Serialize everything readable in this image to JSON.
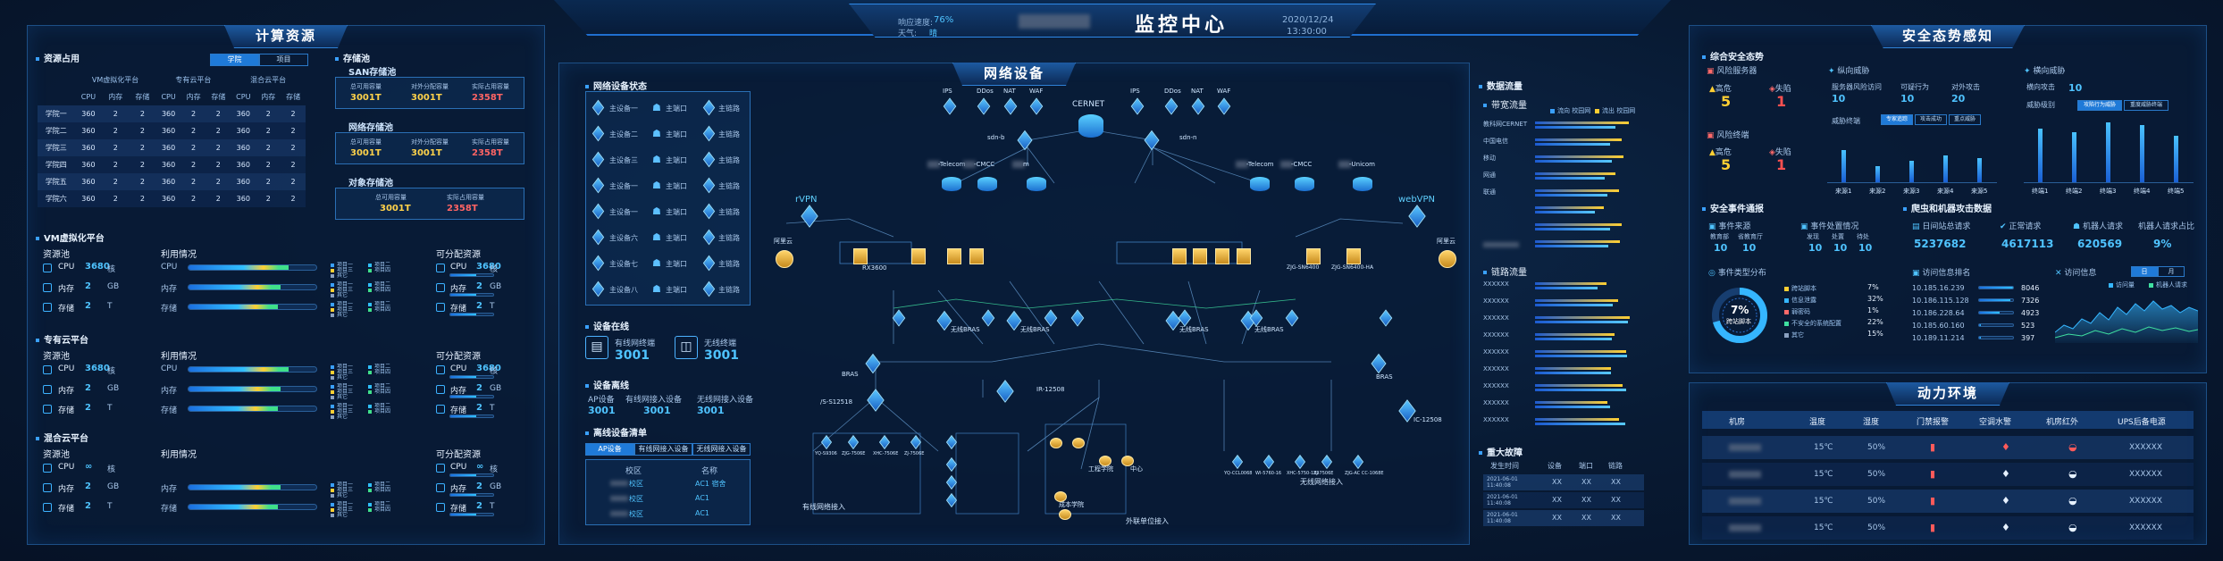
{
  "header": {
    "title": "监控中心",
    "left_label1": "响应速度:",
    "left_val1": "76%",
    "left_label2": "天气:",
    "left_val2": "晴",
    "date": "2020/12/24",
    "time": "13:30:00"
  },
  "left": {
    "title": "计算资源",
    "resource_usage": "资源占用",
    "tabs": [
      "学院",
      "项目"
    ],
    "table_groups": [
      "VM虚拟化平台",
      "专有云平台",
      "混合云平台"
    ],
    "table_cols": [
      "CPU",
      "内存",
      "存储",
      "CPU",
      "内存",
      "存储",
      "CPU",
      "内存",
      "存储"
    ],
    "rows": [
      {
        "name": "学院一",
        "vals": [
          "360",
          "2",
          "2",
          "360",
          "2",
          "2",
          "360",
          "2",
          "2"
        ]
      },
      {
        "name": "学院二",
        "vals": [
          "360",
          "2",
          "2",
          "360",
          "2",
          "2",
          "360",
          "2",
          "2"
        ]
      },
      {
        "name": "学院三",
        "vals": [
          "360",
          "2",
          "2",
          "360",
          "2",
          "2",
          "360",
          "2",
          "2"
        ]
      },
      {
        "name": "学院四",
        "vals": [
          "360",
          "2",
          "2",
          "360",
          "2",
          "2",
          "360",
          "2",
          "2"
        ]
      },
      {
        "name": "学院五",
        "vals": [
          "360",
          "2",
          "2",
          "360",
          "2",
          "2",
          "360",
          "2",
          "2"
        ]
      },
      {
        "name": "学院六",
        "vals": [
          "360",
          "2",
          "2",
          "360",
          "2",
          "2",
          "360",
          "2",
          "2"
        ]
      }
    ],
    "storage": "存储池",
    "san": {
      "title": "SAN存储池",
      "l1": "总可用容量",
      "l2": "对外分配容量",
      "l3": "实际占用容量",
      "v1": "3001T",
      "v2": "3001T",
      "v3": "2358T"
    },
    "nas": {
      "title": "网络存储池",
      "l1": "总可用容量",
      "l2": "对外分配容量",
      "l3": "实际占用容量",
      "v1": "3001T",
      "v2": "3001T",
      "v3": "2358T"
    },
    "obj": {
      "title": "对象存储池",
      "l1": "总可用容量",
      "l2": "实际占用容量",
      "v1": "3001T",
      "v2": "2358T"
    },
    "platforms": [
      {
        "name": "VM虚拟化平台",
        "res": "资源池",
        "use": "利用情况",
        "alloc": "可分配资源",
        "cpu": "3680",
        "mem": "2",
        "disk": "2",
        "u_cpu": "CPU",
        "u_mem": "内存",
        "u_disk": "存储",
        "cpu_pct": 0.78,
        "mem_pct": 0.72,
        "disk_pct": 0.7,
        "a_cpu": "3680",
        "a_mem": "2",
        "a_disk": "2"
      },
      {
        "name": "专有云平台",
        "res": "资源池",
        "use": "利用情况",
        "alloc": "可分配资源",
        "cpu": "3680",
        "mem": "2",
        "disk": "2",
        "u_cpu": "CPU",
        "u_mem": "内存",
        "u_disk": "存储",
        "cpu_pct": 0.78,
        "mem_pct": 0.72,
        "disk_pct": 0.7,
        "a_cpu": "3680",
        "a_mem": "2",
        "a_disk": "2"
      },
      {
        "name": "混合云平台",
        "res": "资源池",
        "use": "利用情况",
        "alloc": "可分配资源",
        "cpu": "∞",
        "mem": "2",
        "disk": "2",
        "u_cpu": "",
        "u_mem": "内存",
        "u_disk": "存储",
        "cpu_pct": 0,
        "mem_pct": 0.72,
        "disk_pct": 0.7,
        "a_cpu": "∞",
        "a_mem": "2",
        "a_disk": "2"
      }
    ],
    "units": {
      "core": "核",
      "gb": "GB",
      "t": "T"
    },
    "legend": [
      "项目一",
      "项目二",
      "项目三",
      "项目四",
      "其它"
    ]
  },
  "middle": {
    "title": "网络设备",
    "status_title": "网络设备状态",
    "devices": [
      {
        "n": "主设备一",
        "a": "主端口",
        "b": "主链路"
      },
      {
        "n": "主设备二",
        "a": "主端口",
        "b": "主链路"
      },
      {
        "n": "主设备三",
        "a": "主端口",
        "b": "主链路"
      },
      {
        "n": "主设备一",
        "a": "主端口",
        "b": "主链路"
      },
      {
        "n": "主设备一",
        "a": "主端口",
        "b": "主链路"
      },
      {
        "n": "主设备六",
        "a": "主端口",
        "b": "主链路"
      },
      {
        "n": "主设备七",
        "a": "主端口",
        "b": "主链路"
      },
      {
        "n": "主设备八",
        "a": "主端口",
        "b": "主链路"
      }
    ],
    "online_title": "设备在线",
    "wired": "有线网终端",
    "wired_v": "3001",
    "wireless": "无线终端",
    "wireless_v": "3001",
    "offline_title": "设备离线",
    "ap": "AP设备",
    "ap_v": "3001",
    "wired_in": "有线网接入设备",
    "wired_in_v": "3001",
    "wireless_in": "无线网接入设备",
    "wireless_in_v": "3001",
    "offline_list": "离线设备清单",
    "list_tabs": [
      "AP设备",
      "有线网接入设备",
      "无线网接入设备"
    ],
    "list_head": [
      "校区",
      "名称"
    ],
    "list_rows": [
      {
        "a": "校区",
        "b": "AC1 宿舍"
      },
      {
        "a": "校区",
        "b": "AC1"
      },
      {
        "a": "校区",
        "b": "AC1"
      }
    ],
    "topo": {
      "top_left": [
        "IPS",
        "DDos",
        "NAT",
        "WAF"
      ],
      "top_right": [
        "IPS",
        "DDos",
        "NAT",
        "WAF"
      ],
      "cernet": "CERNET",
      "sdn_b": "sdn-b",
      "sdn_n": "sdn-n",
      "telecom": "-Telecom",
      "cmcc": "-CMCC",
      "m": "m",
      "telecom2": "-Telecom",
      "cmcc2": "-CMCC",
      "unicom": "-Unicom",
      "rvpn": "rVPN",
      "webvpn": "webVPN",
      "aliyun": "阿里云",
      "aliyun2": "阿里云",
      "rx3600": "RX3600",
      "wbras": "无线BRAS",
      "wbras2": "无线BRAS",
      "wbras3": "无线BRAS",
      "bras": "BRAS",
      "bras2": "BRAS",
      "ir": "IR-12508",
      "s12518": "/S-S12518",
      "c12508": "IC-12508",
      "wired_access": "有线网络接入",
      "wireless_access": "无线网络接入",
      "outside": "外联单位接入",
      "srv_labels": [
        "ZJG-SN6400",
        "ZJG-SN6400-HA"
      ],
      "sub": [
        "YQ-S9306",
        "ZJG-7506E",
        "XHC-7506E",
        "ZJ-7506E"
      ],
      "unit": [
        "工程学院",
        "中心",
        "成本学院"
      ],
      "right_devs": [
        "YQ-CCL0068",
        "WI-5760-16",
        "XHC-5750-182",
        "ZJ-7506E",
        "ZJG-AC CC-1068E"
      ]
    }
  },
  "traffic": {
    "title": "数据流量",
    "bw": "带宽流量",
    "legend": [
      "流向 校园网",
      "流出 校园网"
    ],
    "bw_rows": [
      "教科网CERNET",
      "中国电信",
      "移动",
      "网通",
      "联通"
    ],
    "bw_vals": [
      0.95,
      0.88,
      0.9,
      0.82,
      0.85,
      0.7,
      0.88,
      0.86
    ],
    "link": "链路流量",
    "link_rows": [
      "XXXXXX",
      "XXXXXX",
      "XXXXXX",
      "XXXXXX",
      "XXXXXX",
      "XXXXXX",
      "XXXXXX",
      "XXXXXX",
      "XXXXXX"
    ],
    "fault": "重大故障",
    "fault_head": [
      "发生时间",
      "设备",
      "端口",
      "链路"
    ],
    "fault_rows": [
      {
        "t": "2021-06-01 11:40:08",
        "d": "XX",
        "p": "XX",
        "l": "XX"
      },
      {
        "t": "2021-06-01 11:40:08",
        "d": "XX",
        "p": "XX",
        "l": "XX"
      },
      {
        "t": "2021-06-01 11:40:08",
        "d": "XX",
        "p": "XX",
        "l": "XX"
      }
    ]
  },
  "security": {
    "title": "安全态势感知",
    "overall": "综合安全态势",
    "risk_server": "风险服务器",
    "high": "高危",
    "miss": "失陷",
    "risk_server_high": "5",
    "risk_server_miss": "1",
    "risk_term": "风险终端",
    "risk_term_high": "5",
    "risk_term_miss": "1",
    "vertical": "纵向威胁",
    "v1l": "服务器风险访问",
    "v2l": "可疑行为",
    "v3l": "对外攻击",
    "v1": "10",
    "v2": "10",
    "v3": "20",
    "lateral": "横向威胁",
    "lat_l": "横向攻击",
    "lat_v": "10",
    "threat_hosts": "威胁终端",
    "threat_level": "威胁级别",
    "chart1_tabs": [
      "专家追踪",
      "攻击成功",
      "重点威胁"
    ],
    "chart1_cats": [
      "来源1",
      "来源2",
      "来源3",
      "来源4",
      "来源5"
    ],
    "chart1_vals": [
      60,
      30,
      40,
      50,
      45
    ],
    "chart2_tabs": [
      "攻陷行为威胁",
      "重度威胁终端"
    ],
    "chart2_cats": [
      "终端1",
      "终端2",
      "终端3",
      "终端4",
      "终端5"
    ],
    "chart2_vals": [
      80,
      75,
      90,
      85,
      70
    ],
    "event_report": "安全事件通报",
    "ev_src": "事件来源",
    "ev_src_l": [
      "教育部",
      "省教育厅"
    ],
    "ev_src_v": [
      "10",
      "10"
    ],
    "ev_proc": "事件处置情况",
    "ev_proc_l": [
      "发现",
      "处置",
      "待处"
    ],
    "ev_proc_v": [
      "10",
      "10",
      "10"
    ],
    "crawler": "爬虫和机器攻击数据",
    "daily_req": "日间站总请求",
    "daily_req_v": "5237682",
    "normal_req": "正常请求",
    "normal_req_v": "4617113",
    "bot_req": "机器人请求",
    "bot_req_v": "620569",
    "bot_pct_l": "机器人请求占比",
    "bot_pct_v": "9%",
    "ev_type": "事件类型分布",
    "donut_pct": "7%",
    "donut_label": "跨站脚本",
    "ev_types": [
      {
        "n": "跨站脚本",
        "v": "7%"
      },
      {
        "n": "信息泄露",
        "v": "32%"
      },
      {
        "n": "弱密码",
        "v": "1%"
      },
      {
        "n": "不安全的系统配置",
        "v": "22%"
      },
      {
        "n": "其它",
        "v": "15%"
      }
    ],
    "access_rank": "访问信息排名",
    "ips": [
      {
        "ip": "10.185.16.239",
        "v": "8046"
      },
      {
        "ip": "10.186.115.128",
        "v": "7326"
      },
      {
        "ip": "10.186.228.64",
        "v": "4923"
      },
      {
        "ip": "10.185.60.160",
        "v": "523"
      },
      {
        "ip": "10.189.11.214",
        "v": "397"
      }
    ],
    "visit_trend": "访问信息",
    "trend_tabs": [
      "日",
      "月"
    ],
    "trend_legend": [
      "访问量",
      "机器人请求"
    ],
    "env": "动力环境",
    "env_head": [
      "机房",
      "温度",
      "湿度",
      "门禁报警",
      "空调水警",
      "机房红外",
      "UPS后备电源"
    ],
    "env_rows": [
      {
        "t": "15℃",
        "h": "50%",
        "u": "XXXXXX"
      },
      {
        "t": "15℃",
        "h": "50%",
        "u": "XXXXXX"
      },
      {
        "t": "15℃",
        "h": "50%",
        "u": "XXXXXX"
      },
      {
        "t": "15℃",
        "h": "50%",
        "u": "XXXXXX"
      }
    ]
  }
}
